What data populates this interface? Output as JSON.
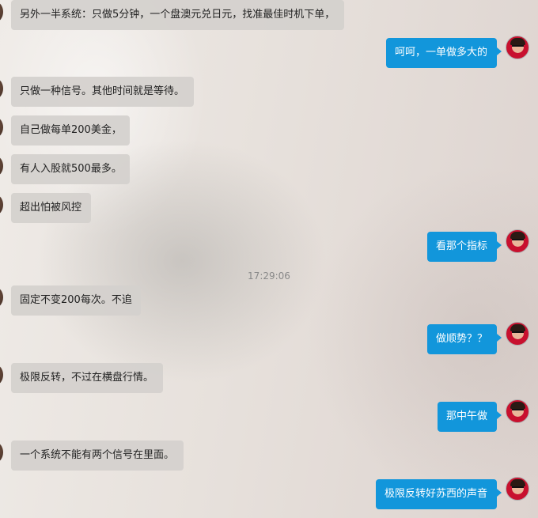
{
  "conversation": {
    "messages": [
      {
        "id": "m1",
        "side": "left",
        "text": "另外一半系统：只做5分钟，一个盘澳元兑日元，找准最佳时机下单，"
      },
      {
        "id": "m2",
        "side": "right",
        "text": "呵呵，一单做多大的"
      },
      {
        "id": "m3",
        "side": "left",
        "text": "只做一种信号。其他时间就是等待。"
      },
      {
        "id": "m4",
        "side": "left",
        "text": "自己做每单200美金，"
      },
      {
        "id": "m5",
        "side": "left",
        "text": "有人入股就500最多。"
      },
      {
        "id": "m6",
        "side": "left",
        "text": "超出怕被风控"
      },
      {
        "id": "m7",
        "side": "right",
        "text": "看那个指标"
      },
      {
        "id": "m8",
        "side": "left",
        "text": "固定不变200每次。不追"
      },
      {
        "id": "m9",
        "side": "right",
        "text": "做顺势？？"
      },
      {
        "id": "m10",
        "side": "left",
        "text": "极限反转，不过在横盘行情。"
      },
      {
        "id": "m11",
        "side": "right",
        "text": "那中午做"
      },
      {
        "id": "m12",
        "side": "left",
        "text": "一个系统不能有两个信号在里面。"
      },
      {
        "id": "m13",
        "side": "right",
        "text": "极限反转好苏西的声音"
      }
    ],
    "timestamp": "17:29:06"
  },
  "colors": {
    "incoming_bubble": "#d4d0cd",
    "outgoing_bubble": "#1296db",
    "incoming_text": "#222222",
    "outgoing_text": "#ffffff"
  },
  "icons": {
    "incoming_avatar": "contact-avatar-icon",
    "outgoing_avatar": "user-avatar-icon"
  }
}
